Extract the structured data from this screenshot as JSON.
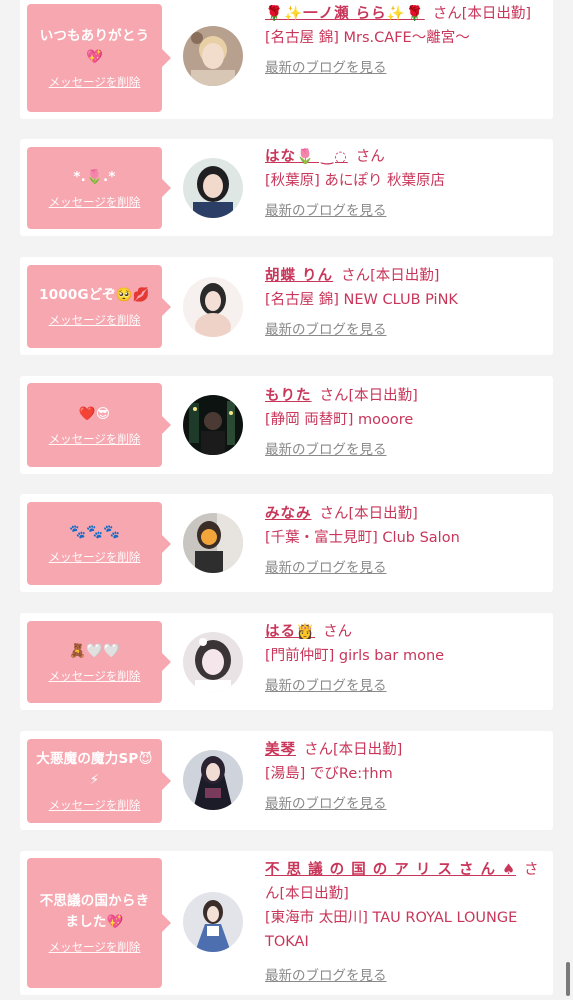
{
  "delete_label": "メッセージを削除",
  "san_label": "さん",
  "blog_label": "最新のブログを見る",
  "colors": {
    "bubble": "#f7a7b0",
    "accent": "#c8365a",
    "muted": "#8a8a8a",
    "background": "#f3f3f3"
  },
  "items": [
    {
      "message": "いつもありがとう💖",
      "name": "🌹✨一ノ瀬 らら✨🌹",
      "status": "[本日出勤]",
      "shop": "[名古屋 錦] Mrs.CAFE〜離宮〜",
      "avatar_icon": "photo-blonde"
    },
    {
      "message": "*.🌷.*",
      "name": "はな🌷 ‿◌",
      "status": "",
      "shop": "[秋葉原] あにぽり 秋葉原店",
      "avatar_icon": "photo-darkhair"
    },
    {
      "message": "1000Gどぞ🥺💋",
      "name": "胡蝶 りん",
      "status": "[本日出勤]",
      "shop": "[名古屋 錦] NEW CLUB PiNK",
      "avatar_icon": "photo-light"
    },
    {
      "message": "❤️😎",
      "name": "もりた",
      "status": "[本日出勤]",
      "shop": "[静岡 両替町] mooore",
      "avatar_icon": "photo-night"
    },
    {
      "message": "🐾🐾🐾",
      "name": "みなみ",
      "status": "[本日出勤]",
      "shop": "[千葉・富士見町] Club Salon",
      "avatar_icon": "photo-mirror"
    },
    {
      "message": "🧸🤍🤍",
      "name": "はる👸",
      "status": "",
      "shop": "[門前仲町] girls bar mone",
      "avatar_icon": "photo-pale"
    },
    {
      "message": "大悪魔の魔力SP😈⚡",
      "name": "美琴",
      "status": "[本日出勤]",
      "shop": "[湯島] でびRe:†hm",
      "avatar_icon": "photo-cosplay"
    },
    {
      "message": "不思議の国からきました💖",
      "name": "不 思 議 の 国 の ア リ ス さ ん ♠",
      "status": "[本日出勤]",
      "shop": "[東海市 太田川] TAU ROYAL LOUNGE TOKAI",
      "avatar_icon": "photo-alice"
    }
  ]
}
